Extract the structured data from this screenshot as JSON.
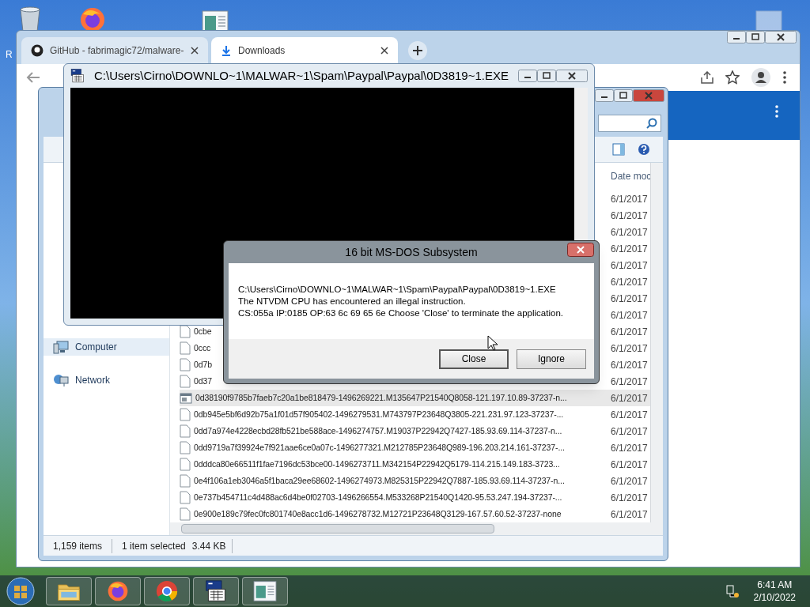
{
  "desktop": {
    "icons": [
      {
        "kind": "bin",
        "label": "R"
      },
      {
        "kind": "firefox"
      },
      {
        "kind": "app"
      },
      {
        "kind": "faded"
      }
    ]
  },
  "browser": {
    "tabs": [
      {
        "title": "GitHub - fabrimagic72/malware-",
        "selected": false,
        "kind": "github"
      },
      {
        "title": "Downloads",
        "selected": true,
        "kind": "download"
      }
    ]
  },
  "explorer": {
    "sidebar": [
      {
        "label": "Computer",
        "selected": true,
        "kind": "computer"
      },
      {
        "label": "Network",
        "selected": false,
        "kind": "network"
      }
    ],
    "column": "Date moc",
    "files": [
      {
        "date": "6/1/2017",
        "selected": false
      },
      {
        "date": "6/1/2017",
        "selected": false
      },
      {
        "date": "6/1/2017",
        "selected": false
      },
      {
        "date": "6/1/2017",
        "selected": false
      },
      {
        "date": "6/1/2017",
        "selected": false
      },
      {
        "date": "6/1/2017",
        "selected": false
      },
      {
        "date": "6/1/2017",
        "selected": false
      },
      {
        "date": "6/1/2017",
        "selected": false
      },
      {
        "name": "0cbe",
        "date": "6/1/2017",
        "selected": false,
        "kind": "file"
      },
      {
        "name": "0ccc",
        "date": "6/1/2017",
        "selected": false,
        "kind": "file"
      },
      {
        "name": "0d7b",
        "date": "6/1/2017",
        "selected": false,
        "kind": "file"
      },
      {
        "name": "0d37",
        "date": "6/1/2017",
        "selected": false,
        "kind": "file"
      },
      {
        "name": "0d38190f9785b7faeb7c20a1be818479-1496269221.M135647P21540Q8058-121.197.10.89-37237-n...",
        "date": "6/1/2017",
        "selected": true,
        "kind": "exe"
      },
      {
        "name": "0db945e5bf6d92b75a1f01d57f905402-1496279531.M743797P23648Q3805-221.231.97.123-37237-...",
        "date": "6/1/2017",
        "selected": false,
        "kind": "file"
      },
      {
        "name": "0dd7a974e4228ecbd28fb521be588ace-1496274757.M19037P22942Q7427-185.93.69.114-37237-n...",
        "date": "6/1/2017",
        "selected": false,
        "kind": "file"
      },
      {
        "name": "0dd9719a7f39924e7f921aae6ce0a07c-1496277321.M212785P23648Q989-196.203.214.161-37237-...",
        "date": "6/1/2017",
        "selected": false,
        "kind": "file"
      },
      {
        "name": "0dddca80e66511f1fae7196dc53bce00-1496273711.M342154P22942Q5179-114.215.149.183-3723...",
        "date": "6/1/2017",
        "selected": false,
        "kind": "file"
      },
      {
        "name": "0e4f106a1eb3046a5f1baca29ee68602-1496274973.M825315P22942Q7887-185.93.69.114-37237-n...",
        "date": "6/1/2017",
        "selected": false,
        "kind": "file"
      },
      {
        "name": "0e737b454711c4d488ac6d4be0f02703-1496266554.M533268P21540Q1420-95.53.247.194-37237-...",
        "date": "6/1/2017",
        "selected": false,
        "kind": "file"
      },
      {
        "name": "0e900e189c79fec0fc801740e8acc1d6-1496278732.M12721P23648Q3129-167.57.60.52-37237-none",
        "date": "6/1/2017",
        "selected": false,
        "kind": "file"
      }
    ],
    "status": {
      "count": "1,159 items",
      "selection": "1 item selected",
      "size": "3.44 KB"
    }
  },
  "console": {
    "title": "C:\\Users\\Cirno\\DOWNLO~1\\MALWAR~1\\Spam\\Paypal\\Paypal\\0D3819~1.EXE"
  },
  "dialog": {
    "title": "16 bit MS-DOS Subsystem",
    "lines": [
      "C:\\Users\\Cirno\\DOWNLO~1\\MALWAR~1\\Spam\\Paypal\\Paypal\\0D3819~1.EXE",
      "The NTVDM CPU has encountered an illegal instruction.",
      "CS:055a IP:0185 OP:63 6c 69 65 6e Choose 'Close' to terminate the application."
    ],
    "buttons": [
      {
        "label": "Close",
        "selected": true
      },
      {
        "label": "Ignore",
        "selected": false
      }
    ]
  },
  "taskbar": {
    "apps": [
      {
        "kind": "folder"
      },
      {
        "kind": "firefox"
      },
      {
        "kind": "chrome"
      },
      {
        "kind": "console"
      },
      {
        "kind": "app"
      }
    ],
    "time": "6:41 AM",
    "date": "2/10/2022"
  }
}
